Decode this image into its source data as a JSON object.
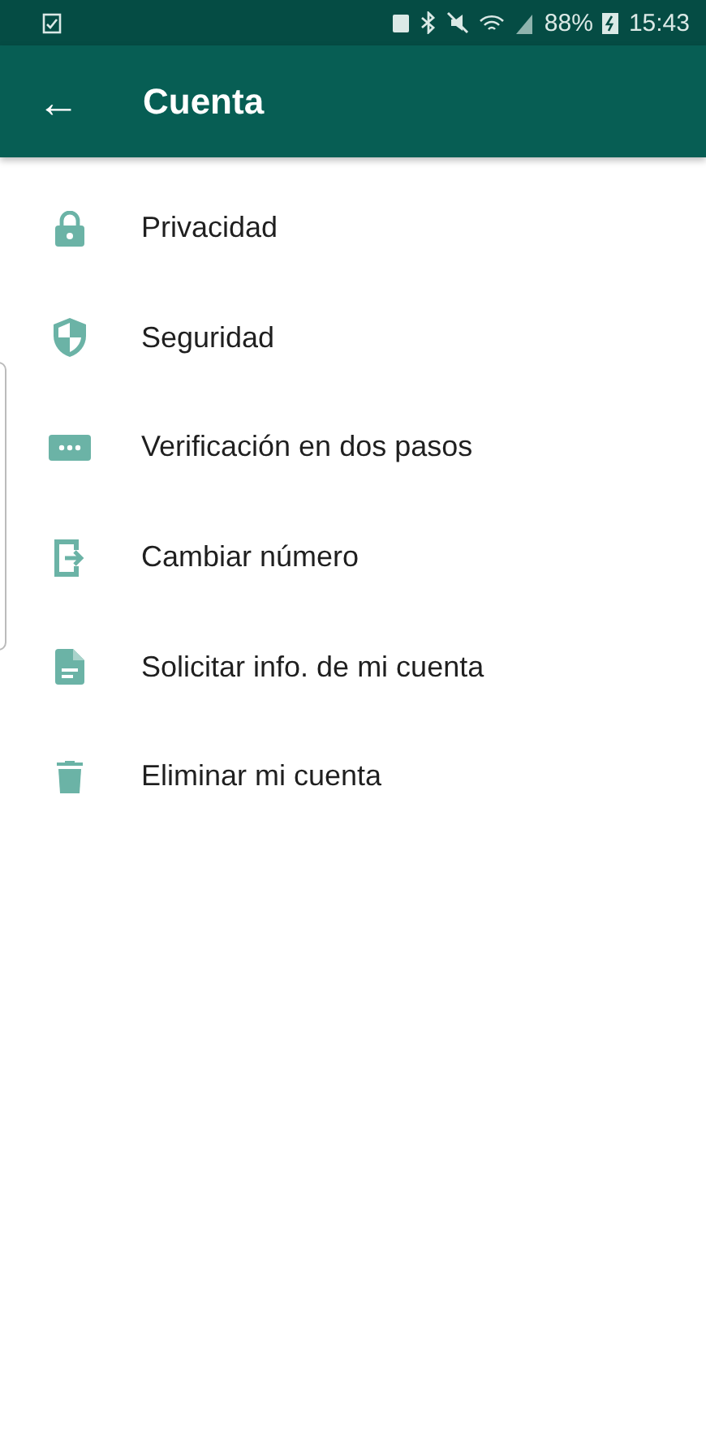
{
  "status_bar": {
    "battery": "88%",
    "time": "15:43"
  },
  "app_bar": {
    "back": "←",
    "title": "Cuenta"
  },
  "items": [
    {
      "kind": "lock",
      "label": "Privacidad"
    },
    {
      "kind": "shield",
      "label": "Seguridad"
    },
    {
      "kind": "dots",
      "label": "Verificación en dos pasos"
    },
    {
      "kind": "exit",
      "label": "Cambiar número"
    },
    {
      "kind": "document",
      "label": "Solicitar info. de mi cuenta"
    },
    {
      "kind": "trash",
      "label": "Eliminar mi cuenta"
    }
  ]
}
